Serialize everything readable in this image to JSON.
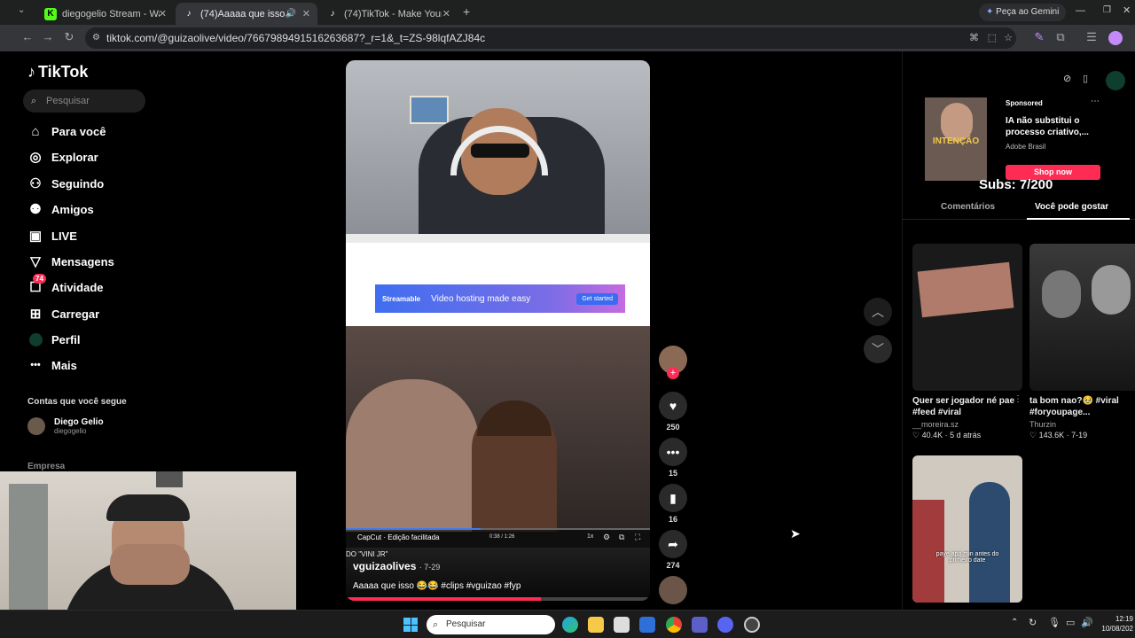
{
  "browser": {
    "tabs": [
      {
        "title": "diegogelio Stream - Watch Live",
        "favicon": "kick-icon",
        "color": "#53fc18",
        "active": false
      },
      {
        "title": "(74)Aaaaa que isso 😂😂 #",
        "favicon": "tiktok-icon",
        "color": "#ffffff",
        "active": true
      },
      {
        "title": "(74)TikTok - Make Your Day",
        "favicon": "tiktok-icon",
        "color": "#ffffff",
        "active": false
      }
    ],
    "gemini_label": "Peça ao Gemini",
    "url": "tiktok.com/@guizaolive/video/7667989491516263687?_r=1&_t=ZS-98lqfAZJ84c"
  },
  "sidebar": {
    "logo": "TikTok",
    "search_placeholder": "Pesquisar",
    "items": [
      {
        "label": "Para você",
        "icon": "home-icon"
      },
      {
        "label": "Explorar",
        "icon": "compass-icon"
      },
      {
        "label": "Seguindo",
        "icon": "following-icon"
      },
      {
        "label": "Amigos",
        "icon": "friends-icon"
      },
      {
        "label": "LIVE",
        "icon": "live-icon"
      },
      {
        "label": "Mensagens",
        "icon": "messages-icon"
      },
      {
        "label": "Atividade",
        "icon": "activity-icon",
        "badge": "74"
      },
      {
        "label": "Carregar",
        "icon": "upload-icon"
      },
      {
        "label": "Perfil",
        "icon": "profile-icon"
      },
      {
        "label": "Mais",
        "icon": "more-icon"
      }
    ],
    "following_title": "Contas que você segue",
    "following": [
      {
        "name": "Diego Gelio",
        "handle": "diegogelio"
      }
    ],
    "footer_label": "Empresa"
  },
  "video": {
    "embedded_banner": "Video hosting made easy",
    "embedded_brand": "Streamable",
    "embedded_cta": "Get started",
    "player_time": "0:38 / 1:26",
    "player_speed": "1x",
    "capcut_label": "CapCut · Edição facilitada",
    "overlay_caption": "DO \"VINI JR\"",
    "author": "vguizaolives",
    "date": "· 7-29",
    "caption": "Aaaaa que isso 😂😂 #clips #vguizao #fyp"
  },
  "actions": {
    "likes": "250",
    "comments": "15",
    "saves": "16",
    "shares": "274"
  },
  "ad": {
    "sponsored_label": "Sponsored",
    "title": "IA não substitui o processo criativo,...",
    "advertiser": "Adobe Brasil",
    "cta": "Shop now",
    "thumb_text": "INTENÇÃO"
  },
  "subs_overlay": "Subs: 7/200",
  "right_tabs": [
    {
      "label": "Comentários",
      "active": false
    },
    {
      "label": "Você pode gostar",
      "active": true
    }
  ],
  "recommendations": [
    {
      "title": "Quer ser jogador né pae #feed #viral",
      "author": "__moreira.sz",
      "views": "40.4K",
      "date": "5 d atrás"
    },
    {
      "title": "ta bom nao?🥹 #viral #foryoupage...",
      "author": "Thurzin",
      "views": "143.6K",
      "date": "7-19"
    },
    {
      "title": "",
      "author": "",
      "views": "",
      "date": "",
      "thumb_text": "paye apó min antes do primeiro date"
    }
  ],
  "taskbar": {
    "search_placeholder": "Pesquisar",
    "time": "12:19",
    "date": "10/08/202"
  },
  "colors": {
    "tiktok_red": "#fe2c55",
    "accent_blue": "#3d7bf0"
  }
}
